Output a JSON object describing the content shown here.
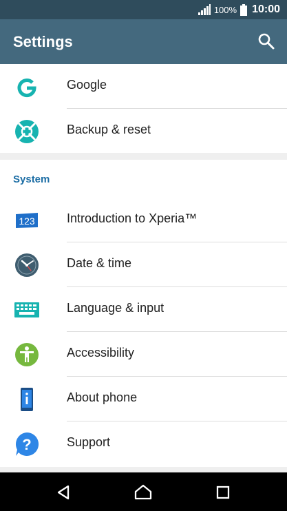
{
  "status_bar": {
    "battery_percent": "100%",
    "time": "10:00",
    "icons": [
      "signal-icon",
      "battery-icon"
    ]
  },
  "app_bar": {
    "title": "Settings",
    "actions": [
      "search-icon"
    ]
  },
  "top_items": [
    {
      "label": "Google",
      "icon": "google-icon"
    },
    {
      "label": "Backup & reset",
      "icon": "backup-reset-icon"
    }
  ],
  "system_section": {
    "header": "System",
    "items": [
      {
        "label": "Introduction to Xperia™",
        "icon": "xperia-intro-icon"
      },
      {
        "label": "Date & time",
        "icon": "clock-icon"
      },
      {
        "label": "Language & input",
        "icon": "keyboard-icon"
      },
      {
        "label": "Accessibility",
        "icon": "accessibility-icon"
      },
      {
        "label": "About phone",
        "icon": "phone-info-icon"
      },
      {
        "label": "Support",
        "icon": "support-icon"
      }
    ]
  },
  "nav_bar": {
    "buttons": [
      "back-icon",
      "home-icon",
      "recents-icon"
    ]
  },
  "colors": {
    "status_bar": "#2f4c5c",
    "app_bar": "#44697e",
    "section_header": "#1d6ea5",
    "accent_teal": "#17b3b0",
    "accessibility_green": "#76b83e"
  }
}
